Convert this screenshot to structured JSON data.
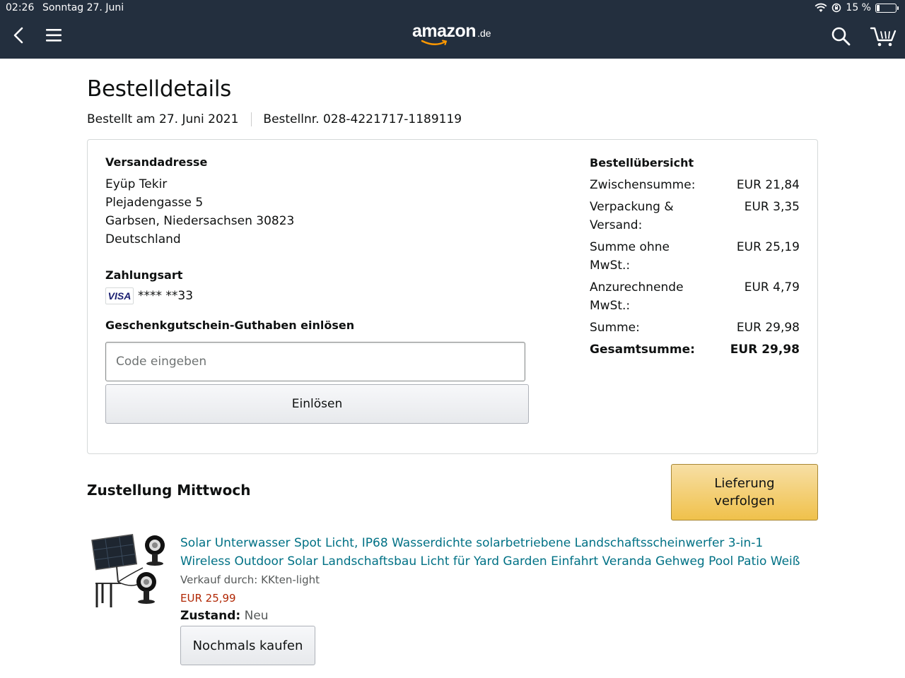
{
  "status_bar": {
    "time": "02:26",
    "date": "Sonntag 27. Juni",
    "battery": "15 %",
    "battery_level": 0.15
  },
  "header": {
    "logo_word": "amazon",
    "logo_tld": ".de",
    "icons": [
      "back-icon",
      "menu-icon",
      "search-icon",
      "cart-icon"
    ]
  },
  "page": {
    "title": "Bestelldetails",
    "ordered_on": "Bestellt am 27. Juni 2021",
    "order_number": "Bestellnr. 028-4221717-1189119"
  },
  "shipping": {
    "heading": "Versandadresse",
    "name": "Eyüp Tekir",
    "street": "Plejadengasse 5",
    "city": "Garbsen, Niedersachsen 30823",
    "country": "Deutschland"
  },
  "payment": {
    "heading": "Zahlungsart",
    "card_brand": "VISA",
    "card_digits": "**** **33"
  },
  "gift_card": {
    "heading": "Geschenkgutschein-Guthaben einlösen",
    "placeholder": "Code eingeben",
    "value": "",
    "redeem_label": "Einlösen"
  },
  "summary": {
    "heading": "Bestellübersicht",
    "rows": [
      {
        "label": "Zwischensumme:",
        "value": "EUR 21,84"
      },
      {
        "label": "Verpackung & Versand:",
        "value": "EUR 3,35"
      },
      {
        "label": "Summe ohne MwSt.:",
        "value": "EUR 25,19"
      },
      {
        "label": "Anzurechnende MwSt.:",
        "value": "EUR 4,79"
      },
      {
        "label": "Summe:",
        "value": "EUR 29,98"
      },
      {
        "label": "Gesamtsumme:",
        "value": "EUR 29,98"
      }
    ]
  },
  "delivery": {
    "heading": "Zustellung Mittwoch",
    "track_label": "Lieferung verfolgen"
  },
  "item": {
    "title": "Solar Unterwasser Spot Licht, IP68 Wasserdichte solarbetriebene Landschaftsscheinwerfer 3-in-1 Wireless Outdoor Solar Landschaftsbau Licht für Yard Garden Einfahrt Veranda Gehweg Pool Patio Weiß",
    "seller": "Verkauf durch: KKten-light",
    "price": "EUR 25,99",
    "condition_label": "Zustand:",
    "condition_value": "Neu",
    "buy_again_label": "Nochmals kaufen"
  },
  "colors": {
    "header_bg": "#232f3e",
    "link": "#007185",
    "price": "#b12704",
    "primary_button": "#f0c14b"
  }
}
